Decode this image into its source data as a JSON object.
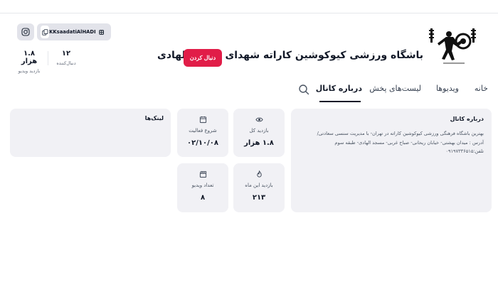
{
  "header": {
    "channel_title": "باشگاه ورزشی کیوکوشین کاراته شهدای مسجد الهادی",
    "follow_label": "دنبال کردن",
    "followers_value": "۱۲",
    "followers_label": "دنبال‌کننده",
    "views_value": "۱.۸ هزار",
    "views_label": "بازدید ویدیو"
  },
  "tabs": {
    "home": "خانه",
    "videos": "ویدیوها",
    "playlists": "لیست‌های پخش",
    "about": "درباره کانال"
  },
  "about": {
    "title": "درباره کانال",
    "lines": [
      "بهترین باشگاه فرهنگی ورزشی کیوکوشین کاراته در تهران- با مدیریت سنسی سعادتی/",
      "آدرس : میدان بهشتی- خیابان ریحانی- صباح غربی- مسجد الهادی- طبقه سوم",
      "تلفن:۰۹۱۹۷۳۳۶۵۱۵"
    ]
  },
  "stats": {
    "total_views_label": "بازدید کل",
    "total_views_value": "۱.۸ هزار",
    "start_label": "شروع فعالیت",
    "start_value": "۰۲/۱۰/۰۸",
    "month_views_label": "بازدید این ماه",
    "month_views_value": "۲۱۳",
    "video_count_label": "تعداد ویدیو",
    "video_count_value": "۸"
  },
  "links": {
    "title": "لینک‌ها",
    "primary_text": "KKsaadatiAlHADI",
    "icons": [
      "instagram-icon",
      "copy-icon",
      "aparat-icon"
    ]
  },
  "colors": {
    "accent": "#e11d48",
    "card_bg": "#f1f1f5",
    "chip_bg": "#e2e3ea"
  }
}
